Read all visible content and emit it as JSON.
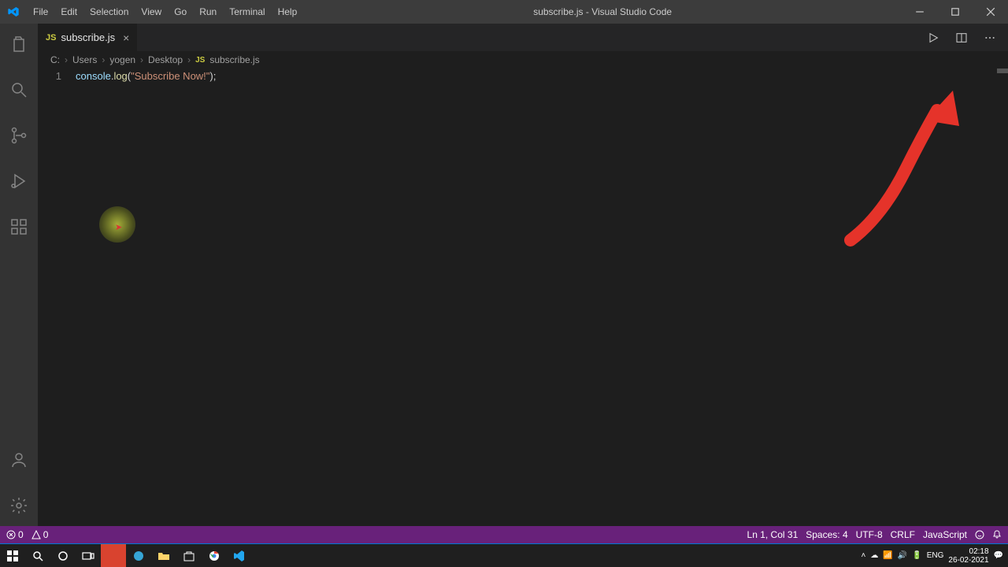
{
  "title": "subscribe.js - Visual Studio Code",
  "menu": [
    "File",
    "Edit",
    "Selection",
    "View",
    "Go",
    "Run",
    "Terminal",
    "Help"
  ],
  "tab": {
    "name": "subscribe.js"
  },
  "breadcrumbs": [
    "C:",
    "Users",
    "yogen",
    "Desktop"
  ],
  "breadcrumb_file": "subscribe.js",
  "code": {
    "line_no": "1",
    "obj": "console",
    "dot": ".",
    "method": "log",
    "open": "(",
    "string": "\"Subscribe Now!\"",
    "close": ");"
  },
  "status": {
    "errors": "0",
    "warnings": "0",
    "ln_col": "Ln 1, Col 31",
    "spaces": "Spaces: 4",
    "encoding": "UTF-8",
    "eol": "CRLF",
    "lang": "JavaScript"
  },
  "tray": {
    "lang": "ENG",
    "time": "02:18",
    "date": "26-02-2021"
  }
}
